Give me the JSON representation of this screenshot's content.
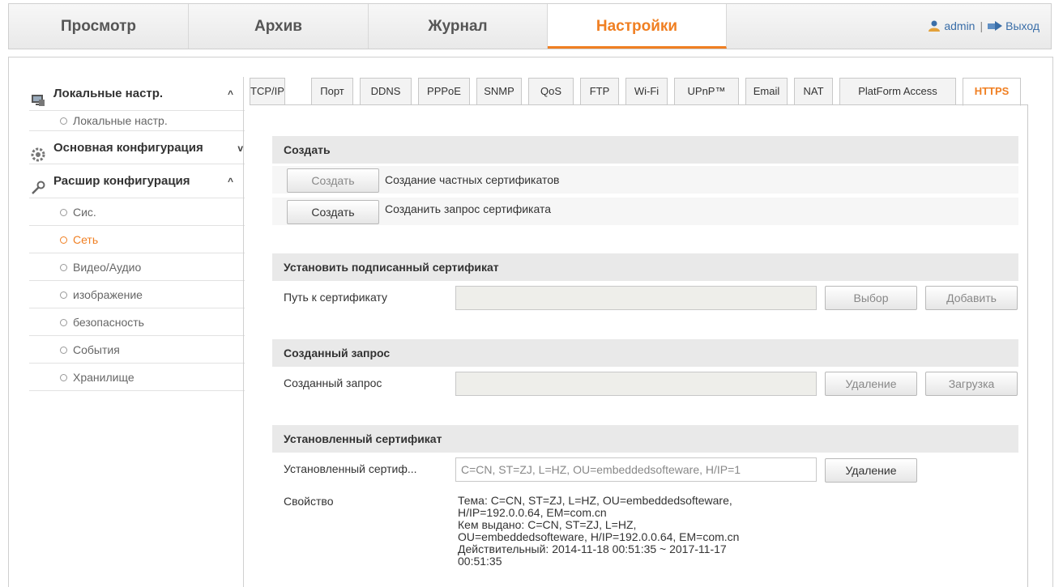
{
  "topnav": {
    "tabs": [
      {
        "label": "Просмотр"
      },
      {
        "label": "Архив"
      },
      {
        "label": "Журнал"
      },
      {
        "label": "Настройки"
      }
    ],
    "user": "admin",
    "separator": "|",
    "logout": "Выход"
  },
  "sidebar": {
    "local_group": "Локальные настр.",
    "local_item": "Локальные настр.",
    "basic_group": "Основная конфигурация",
    "advanced_group": "Расшир конфигурация",
    "items": [
      "Сис.",
      "Сеть",
      "Видео/Аудио",
      "изображение",
      "безопасность",
      "События",
      "Хранилище"
    ]
  },
  "tabs": [
    "TCP/IP",
    "Порт",
    "DDNS",
    "PPPoE",
    "SNMP",
    "QoS",
    "FTP",
    "Wi-Fi",
    "UPnP™",
    "Email",
    "NAT",
    "PlatForm Access",
    "HTTPS"
  ],
  "create": {
    "title": "Создать",
    "btn1": "Создать",
    "desc1": "Создание частных сертификатов",
    "btn2": "Создать",
    "desc2": "Созданить запрос сертификата"
  },
  "install_signed": {
    "title": "Установить подписанный сертификат",
    "path_label": "Путь к сертификату",
    "path_value": "",
    "browse": "Выбор",
    "add": "Добавить"
  },
  "created_request": {
    "title": "Созданный запрос",
    "label": "Созданный запрос",
    "value": "",
    "delete": "Удаление",
    "download": "Загрузка"
  },
  "installed": {
    "title": "Установленный сертификат",
    "label": "Установленный сертиф...",
    "value": "C=CN, ST=ZJ, L=HZ, OU=embeddedsofteware, H/IP=1",
    "delete": "Удаление",
    "prop_label": "Свойство",
    "prop_lines": [
      "Тема: C=CN, ST=ZJ, L=HZ, OU=embeddedsofteware,",
      "H/IP=192.0.0.64, EM=com.cn",
      "Кем выдано: C=CN, ST=ZJ, L=HZ,",
      "OU=embeddedsofteware, H/IP=192.0.0.64, EM=com.cn",
      "Действительный: 2014-11-18 00:51:35 ~ 2017-11-17",
      "00:51:35"
    ]
  },
  "colors": {
    "accent": "#f07f22",
    "link": "#3a6ea8"
  }
}
